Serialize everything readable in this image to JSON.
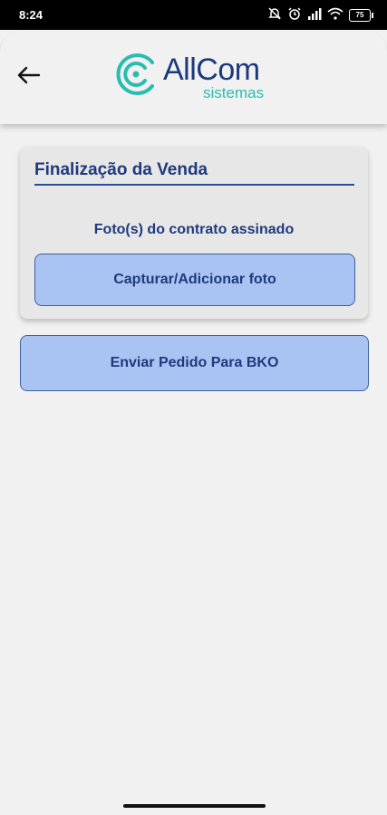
{
  "status_bar": {
    "time": "8:24",
    "battery": "75"
  },
  "header": {
    "logo_title": "AllCom",
    "logo_subtitle": "sistemas"
  },
  "card": {
    "title": "Finalização da Venda",
    "photo_label": "Foto(s) do contrato assinado",
    "capture_button": "Capturar/Adicionar foto"
  },
  "send_button": "Enviar Pedido Para BKO",
  "colors": {
    "accent_blue": "#1f3a7c",
    "button_fill": "#a9c4f2",
    "logo_teal": "#2bbcb0"
  }
}
